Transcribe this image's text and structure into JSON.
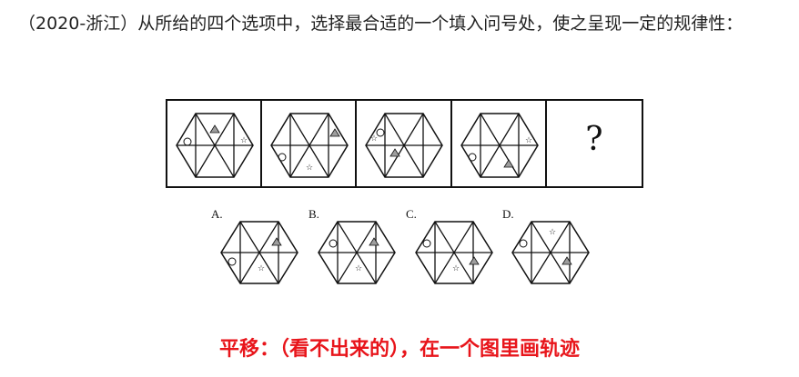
{
  "question_text": "（2020-浙江）从所给的四个选项中，选择最合适的一个填入问号处，使之呈现一定的规律性：",
  "question_mark": "?",
  "options": [
    {
      "label": "A."
    },
    {
      "label": "B."
    },
    {
      "label": "C."
    },
    {
      "label": "D."
    }
  ],
  "note": "平移：（看不出来的），在一个图里画轨迹",
  "colors": {
    "note": "#e8151b",
    "triangle_fill": "#9e9e9e",
    "line": "#111111"
  },
  "icons": [
    "hexagon-figure",
    "circle-icon",
    "triangle-icon",
    "star-icon"
  ]
}
